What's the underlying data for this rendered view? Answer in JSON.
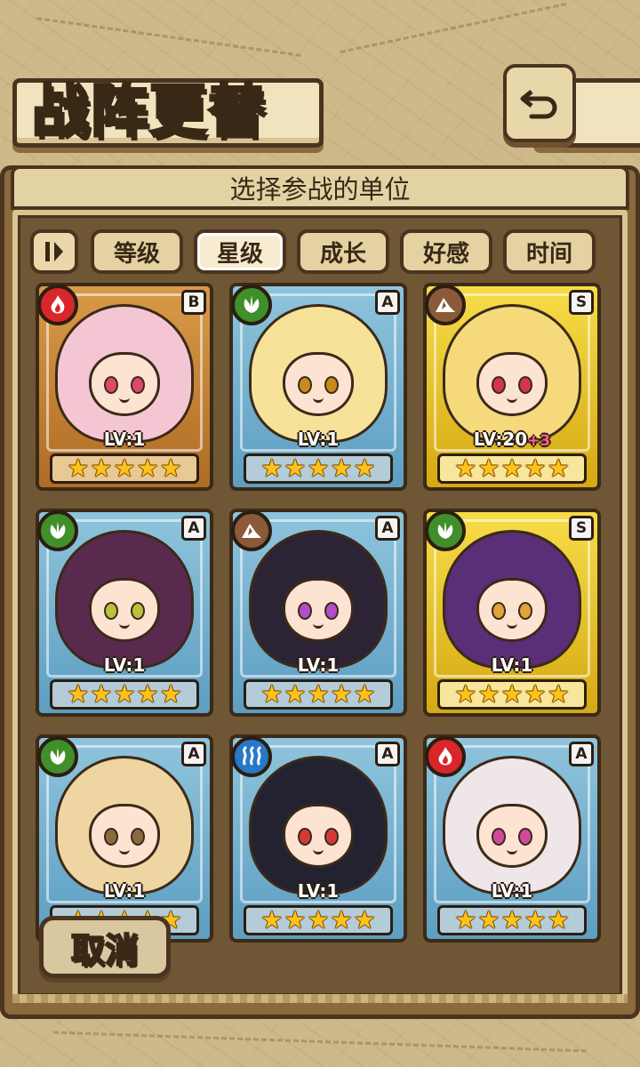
{
  "header": {
    "title": "战阵更替"
  },
  "panel": {
    "subtitle": "选择参战的单位"
  },
  "sort": {
    "options": [
      "等级",
      "星级",
      "成长",
      "好感",
      "时间"
    ],
    "selected": "星级"
  },
  "units": [
    {
      "element": "fire",
      "rarity": "B",
      "level": "LV:1",
      "bonus": "",
      "stars": 5,
      "hair": "#f4c6d4",
      "eyes": "#e0476a"
    },
    {
      "element": "plant",
      "rarity": "A",
      "level": "LV:1",
      "bonus": "",
      "stars": 5,
      "hair": "#f7e29a",
      "eyes": "#c78a1c"
    },
    {
      "element": "earth",
      "rarity": "S",
      "level": "LV:20",
      "bonus": "+3",
      "stars": 5,
      "hair": "#f6d97a",
      "eyes": "#d2364a"
    },
    {
      "element": "plant",
      "rarity": "A",
      "level": "LV:1",
      "bonus": "",
      "stars": 5,
      "hair": "#5a2a4e",
      "eyes": "#b9c23a"
    },
    {
      "element": "earth",
      "rarity": "A",
      "level": "LV:1",
      "bonus": "",
      "stars": 5,
      "hair": "#2c2435",
      "eyes": "#b04fc8"
    },
    {
      "element": "plant",
      "rarity": "S",
      "level": "LV:1",
      "bonus": "",
      "stars": 5,
      "hair": "#5a2f78",
      "eyes": "#e0a43a"
    },
    {
      "element": "plant",
      "rarity": "A",
      "level": "LV:1",
      "bonus": "",
      "stars": 5,
      "hair": "#eed5a2",
      "eyes": "#8a6a3c"
    },
    {
      "element": "water",
      "rarity": "A",
      "level": "LV:1",
      "bonus": "",
      "stars": 5,
      "hair": "#222230",
      "eyes": "#d23a3a"
    },
    {
      "element": "fire",
      "rarity": "A",
      "level": "LV:1",
      "bonus": "",
      "stars": 5,
      "hair": "#efe6ea",
      "eyes": "#d24a9a"
    }
  ],
  "element_colors": {
    "fire": "#d9262a",
    "plant": "#3f8f2a",
    "earth": "#8a5a3a",
    "water": "#2878c8"
  },
  "actions": {
    "cancel": "取消"
  }
}
